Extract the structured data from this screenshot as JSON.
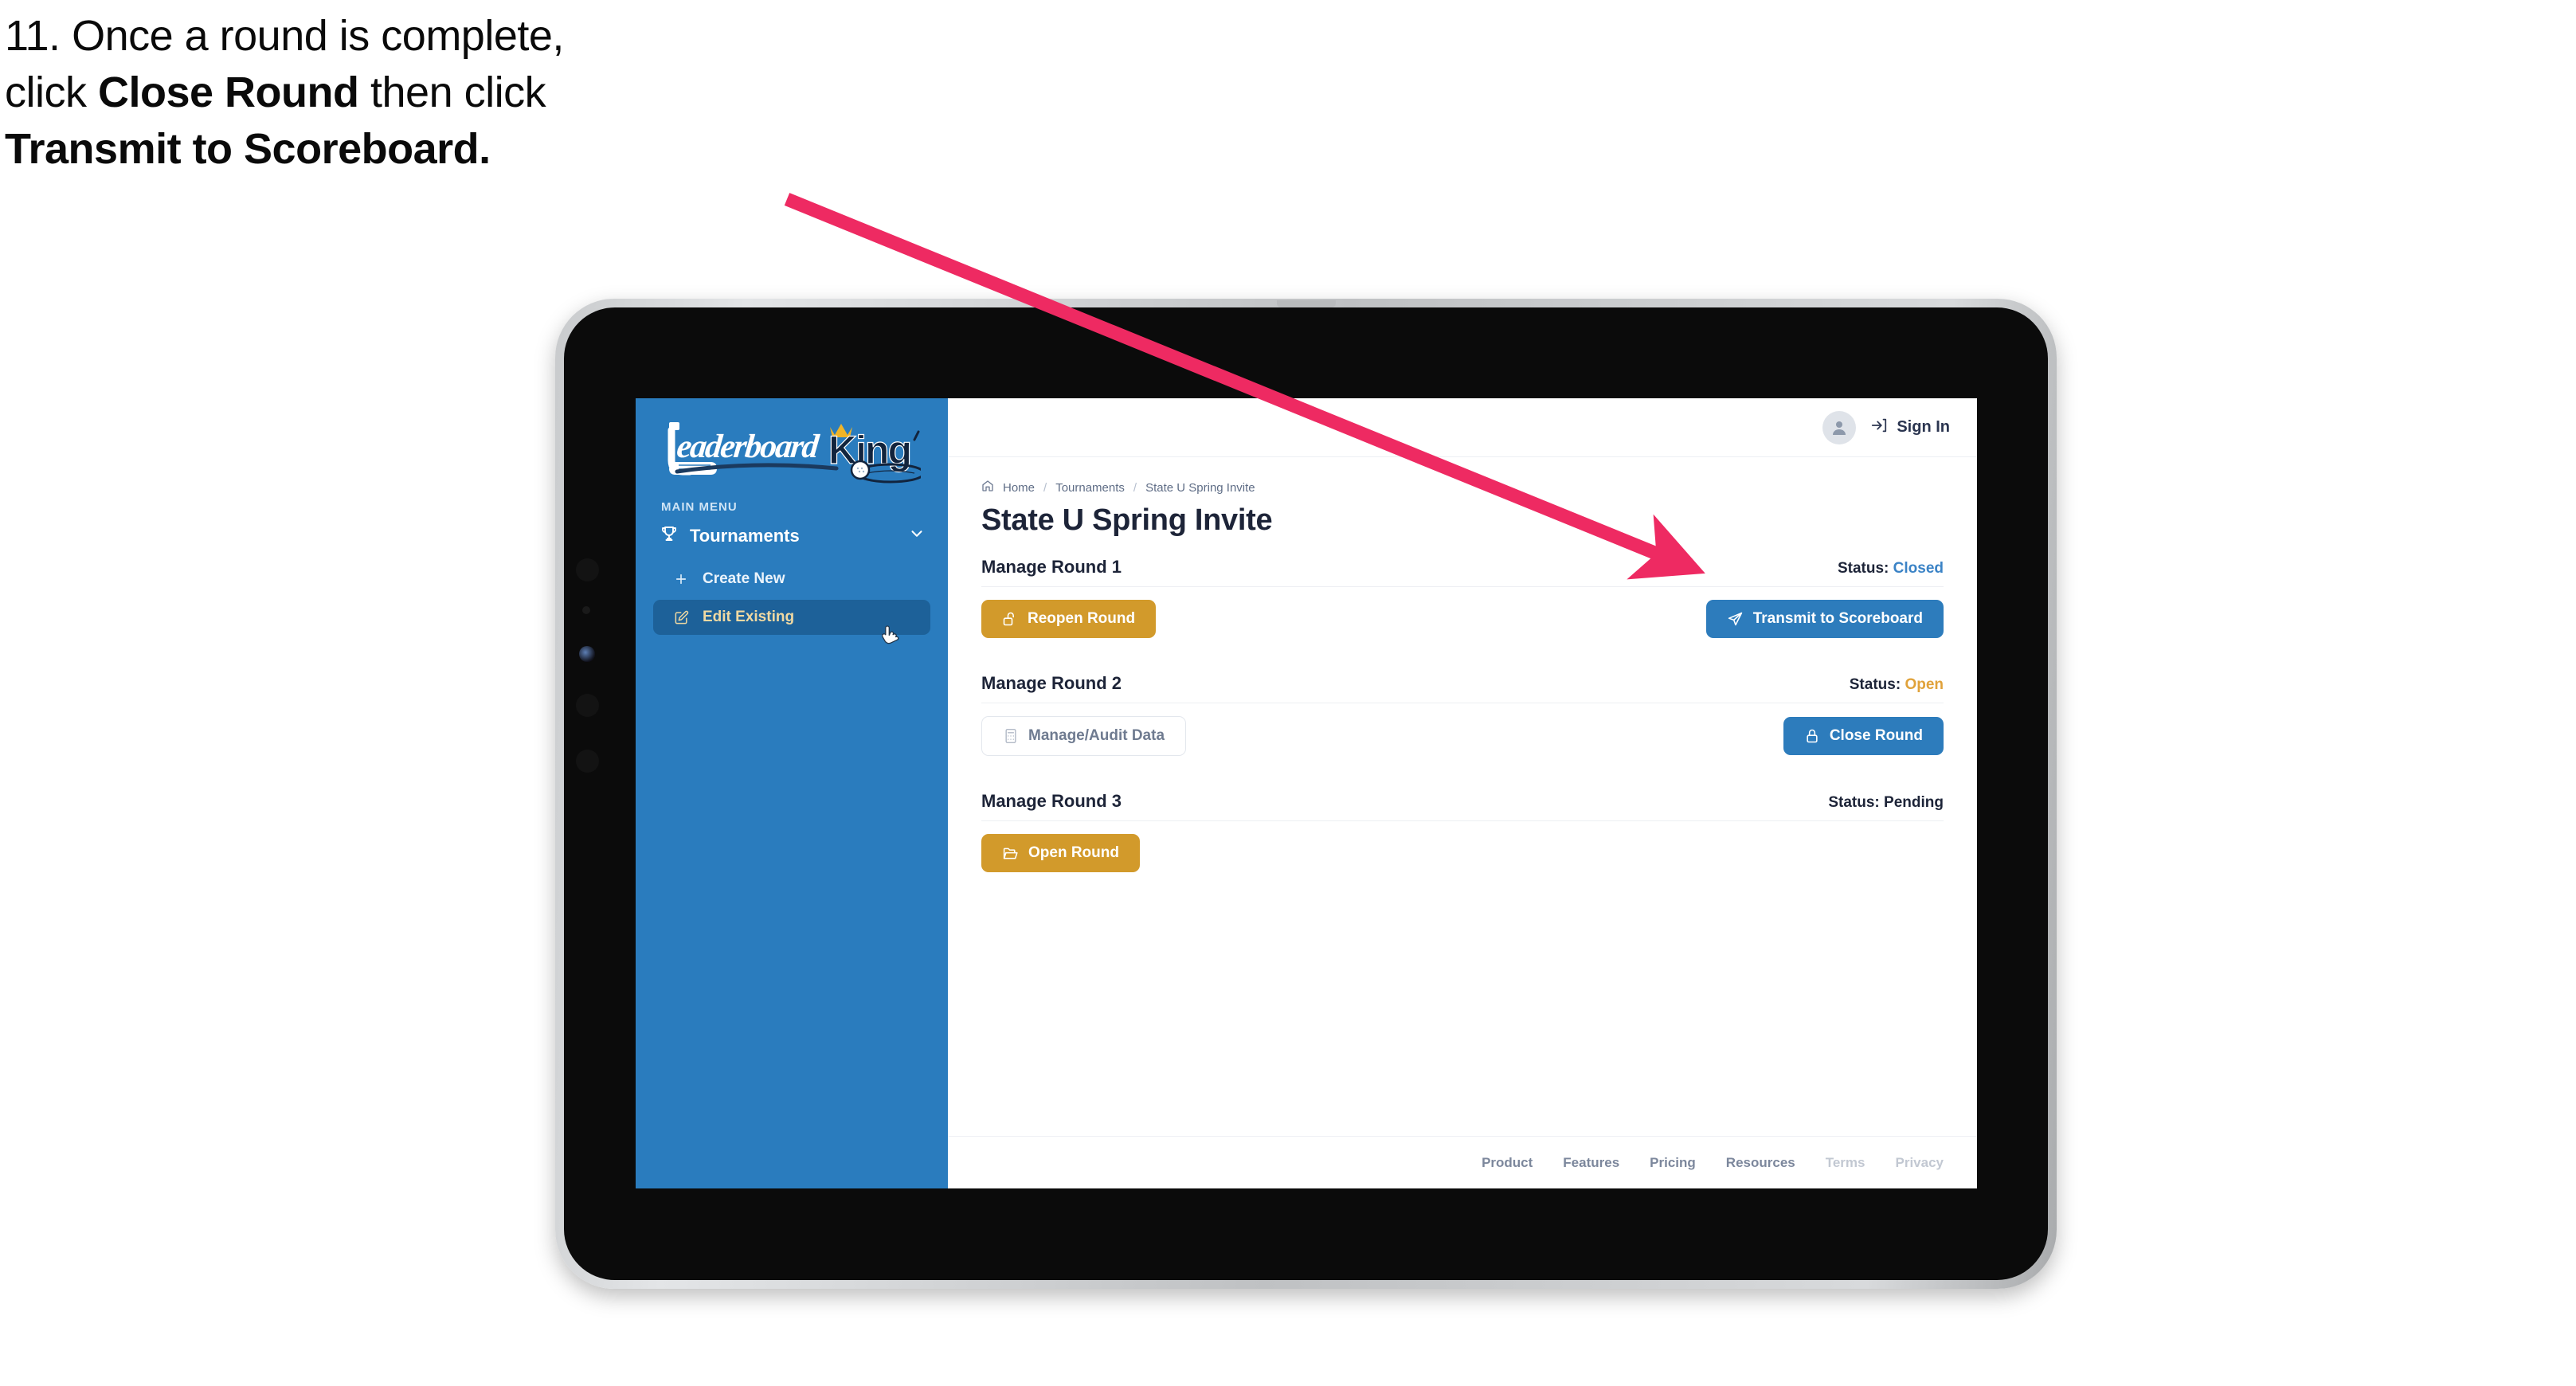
{
  "caption": {
    "line1_plain": "11. Once a round is complete,",
    "line2_pre": "click ",
    "line2_bold": "Close Round",
    "line2_post": " then click",
    "line3_bold": "Transmit to Scoreboard."
  },
  "brand": {
    "logo_word_1": "Leaderboard",
    "logo_word_2": "King"
  },
  "sidebar": {
    "menu_label": "MAIN MENU",
    "items": [
      {
        "label": "Tournaments",
        "icon": "trophy-icon",
        "chevron": "chevron-down-icon",
        "active": false
      },
      {
        "label": "Create New",
        "icon": "plus-icon",
        "active": false
      },
      {
        "label": "Edit Existing",
        "icon": "edit-pencil-icon",
        "active": true
      }
    ]
  },
  "topbar": {
    "avatar_icon": "user-avatar-icon",
    "signin_icon": "login-arrow-icon",
    "signin_label": "Sign In"
  },
  "breadcrumb": {
    "home_icon": "home-icon",
    "items": [
      "Home",
      "Tournaments",
      "State U Spring Invite"
    ],
    "separator": "/"
  },
  "page": {
    "title": "State U Spring Invite"
  },
  "rounds": [
    {
      "title": "Manage Round 1",
      "status_label": "Status:",
      "status_value": "Closed",
      "status_kind": "closed",
      "left_button": {
        "label": "Reopen Round",
        "icon": "unlock-icon",
        "style": "gold"
      },
      "right_button": {
        "label": "Transmit to Scoreboard",
        "icon": "paper-plane-icon",
        "style": "blue"
      }
    },
    {
      "title": "Manage Round 2",
      "status_label": "Status:",
      "status_value": "Open",
      "status_kind": "open",
      "left_button": {
        "label": "Manage/Audit Data",
        "icon": "calculator-icon",
        "style": "ghost"
      },
      "right_button": {
        "label": "Close Round",
        "icon": "lock-icon",
        "style": "blue"
      }
    },
    {
      "title": "Manage Round 3",
      "status_label": "Status:",
      "status_value": "Pending",
      "status_kind": "pending",
      "left_button": {
        "label": "Open Round",
        "icon": "open-folder-icon",
        "style": "gold"
      },
      "right_button": null
    }
  ],
  "footer": {
    "links": [
      {
        "label": "Product",
        "dim": false
      },
      {
        "label": "Features",
        "dim": false
      },
      {
        "label": "Pricing",
        "dim": false
      },
      {
        "label": "Resources",
        "dim": false
      },
      {
        "label": "Terms",
        "dim": true
      },
      {
        "label": "Privacy",
        "dim": true
      }
    ]
  },
  "colors": {
    "sidebar_blue": "#2a7cbe",
    "sidebar_active": "#1d6199",
    "accent_gold": "#d29a2b",
    "accent_blue": "#2d7cbc",
    "status_open": "#e0a23a",
    "status_closed": "#3b83c6",
    "arrow_pink": "#ee2a62",
    "text_dark": "#1d2438"
  },
  "annotation": {
    "arrow_icon": "pointer-arrow-icon",
    "cursor_icon": "pointing-hand-cursor-icon"
  }
}
